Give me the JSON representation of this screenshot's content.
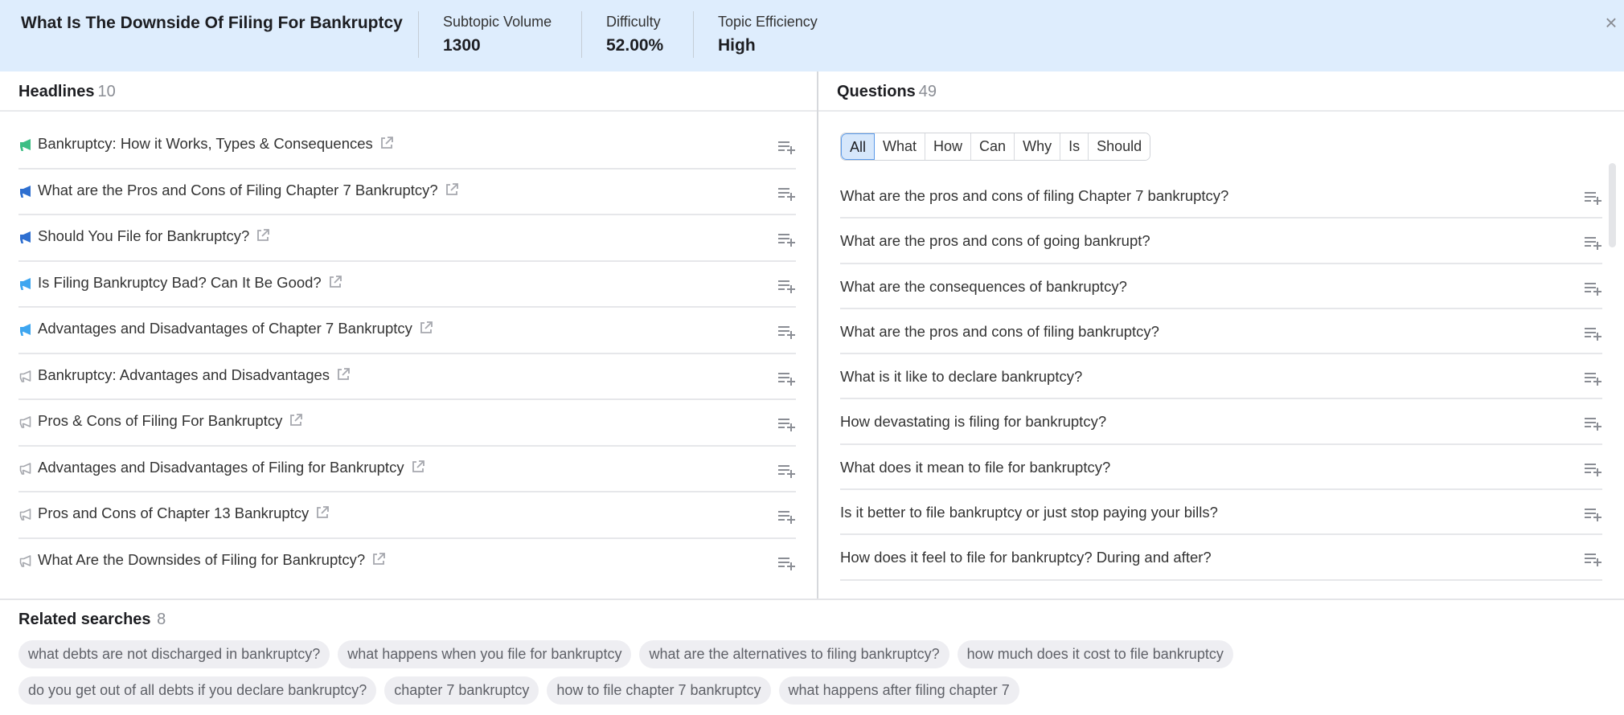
{
  "header": {
    "title": "What Is The Downside Of Filing For Bankruptcy",
    "metrics": [
      {
        "label": "Subtopic Volume",
        "value": "1300"
      },
      {
        "label": "Difficulty",
        "value": "52.00%"
      },
      {
        "label": "Topic Efficiency",
        "value": "High"
      }
    ],
    "close_icon": "×"
  },
  "headlines": {
    "title": "Headlines",
    "count": "10",
    "items": [
      {
        "text": "Bankruptcy: How it Works, Types & Consequences",
        "icon_color": "#3cbe84"
      },
      {
        "text": "What are the Pros and Cons of Filing Chapter 7 Bankruptcy?",
        "icon_color": "#2e6fd0"
      },
      {
        "text": "Should You File for Bankruptcy?",
        "icon_color": "#2e6fd0"
      },
      {
        "text": "Is Filing Bankruptcy Bad? Can It Be Good?",
        "icon_color": "#3ea6f0"
      },
      {
        "text": "Advantages and Disadvantages of Chapter 7 Bankruptcy",
        "icon_color": "#3ea6f0"
      },
      {
        "text": "Bankruptcy: Advantages and Disadvantages",
        "icon_color": "#a6a8ae"
      },
      {
        "text": "Pros & Cons of Filing For Bankruptcy",
        "icon_color": "#a6a8ae"
      },
      {
        "text": "Advantages and Disadvantages of Filing for Bankruptcy",
        "icon_color": "#a6a8ae"
      },
      {
        "text": "Pros and Cons of Chapter 13 Bankruptcy",
        "icon_color": "#a6a8ae"
      },
      {
        "text": "What Are the Downsides of Filing for Bankruptcy?",
        "icon_color": "#a6a8ae"
      }
    ]
  },
  "questions": {
    "title": "Questions",
    "count": "49",
    "filters": [
      "All",
      "What",
      "How",
      "Can",
      "Why",
      "Is",
      "Should"
    ],
    "active_filter": "All",
    "items": [
      "What are the pros and cons of filing Chapter 7 bankruptcy?",
      "What are the pros and cons of going bankrupt?",
      "What are the consequences of bankruptcy?",
      "What are the pros and cons of filing bankruptcy?",
      "What is it like to declare bankruptcy?",
      "How devastating is filing for bankruptcy?",
      "What does it mean to file for bankruptcy?",
      "Is it better to file bankruptcy or just stop paying your bills?",
      "How does it feel to file for bankruptcy? During and after?"
    ]
  },
  "related": {
    "title": "Related searches",
    "count": "8",
    "chips": [
      "what debts are not discharged in bankruptcy?",
      "what happens when you file for bankruptcy",
      "what are the alternatives to filing bankruptcy?",
      "how much does it cost to file bankruptcy",
      "do you get out of all debts if you declare bankruptcy?",
      "chapter 7 bankruptcy",
      "how to file chapter 7 bankruptcy",
      "what happens after filing chapter 7"
    ]
  }
}
